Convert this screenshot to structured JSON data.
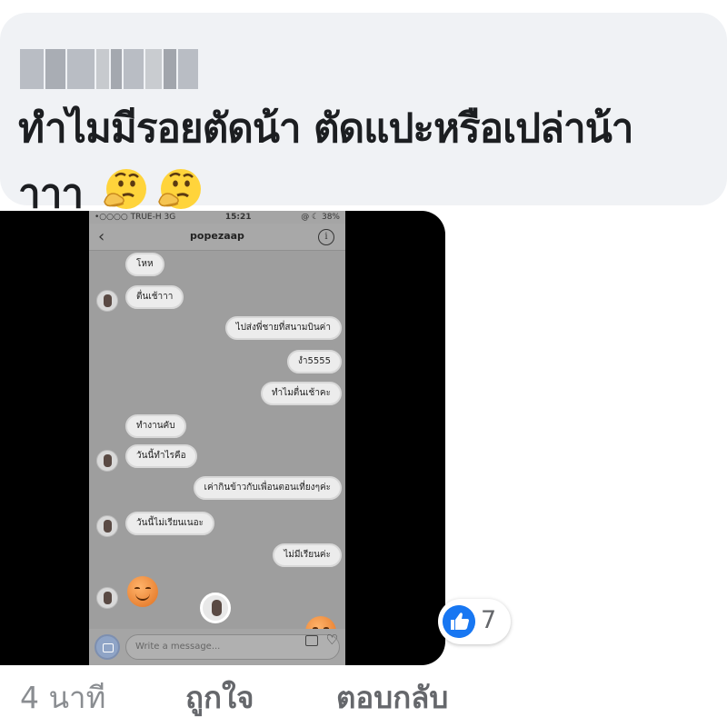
{
  "comment": {
    "author": "",
    "text_line1": "ทำไมมีรอยตัดน้า ตัดแปะหรือเปล่าน้า",
    "text_line2": "าาา",
    "emoji": [
      "thinking-face",
      "thinking-face"
    ]
  },
  "screenshot": {
    "status_bar": {
      "carrier": "•○○○○ TRUE-H  3G",
      "time": "15:21",
      "battery": "@ ☾ 38%"
    },
    "nav": {
      "back": "‹",
      "title": "popezaap",
      "info": "i"
    },
    "messages": [
      {
        "side": "in",
        "avatar": false,
        "text": "โหห"
      },
      {
        "side": "in",
        "avatar": true,
        "text": "ตื่นเช้าาา"
      },
      {
        "side": "out",
        "text": "ไปส่งพี่ชายที่สนามบินค่า"
      },
      {
        "side": "out",
        "text": "งํา5555"
      },
      {
        "side": "out",
        "text": "ทำไมตื่นเช้าคะ"
      },
      {
        "side": "in",
        "avatar": false,
        "text": "ทำงานคับ"
      },
      {
        "side": "in",
        "avatar": true,
        "text": "วันนี้ทำไรคือ"
      },
      {
        "side": "out",
        "text": "เค่ากินข้าวกับเพื่อนตอนเที่ยงๆค่ะ"
      },
      {
        "side": "in",
        "avatar": true,
        "text": "วันนี้ไม่เรียนเนอะ"
      },
      {
        "side": "out",
        "text": "ไม่มีเรียนค่ะ"
      }
    ],
    "composer_placeholder": "Write a message..."
  },
  "reactions": {
    "icon": "like-icon",
    "count": "7"
  },
  "footer": {
    "time": "4 นาที",
    "like": "ถูกใจ",
    "reply": "ตอบกลับ"
  },
  "colors": {
    "like_blue": "#1877f2",
    "bubble_bg": "#f0f2f5"
  }
}
